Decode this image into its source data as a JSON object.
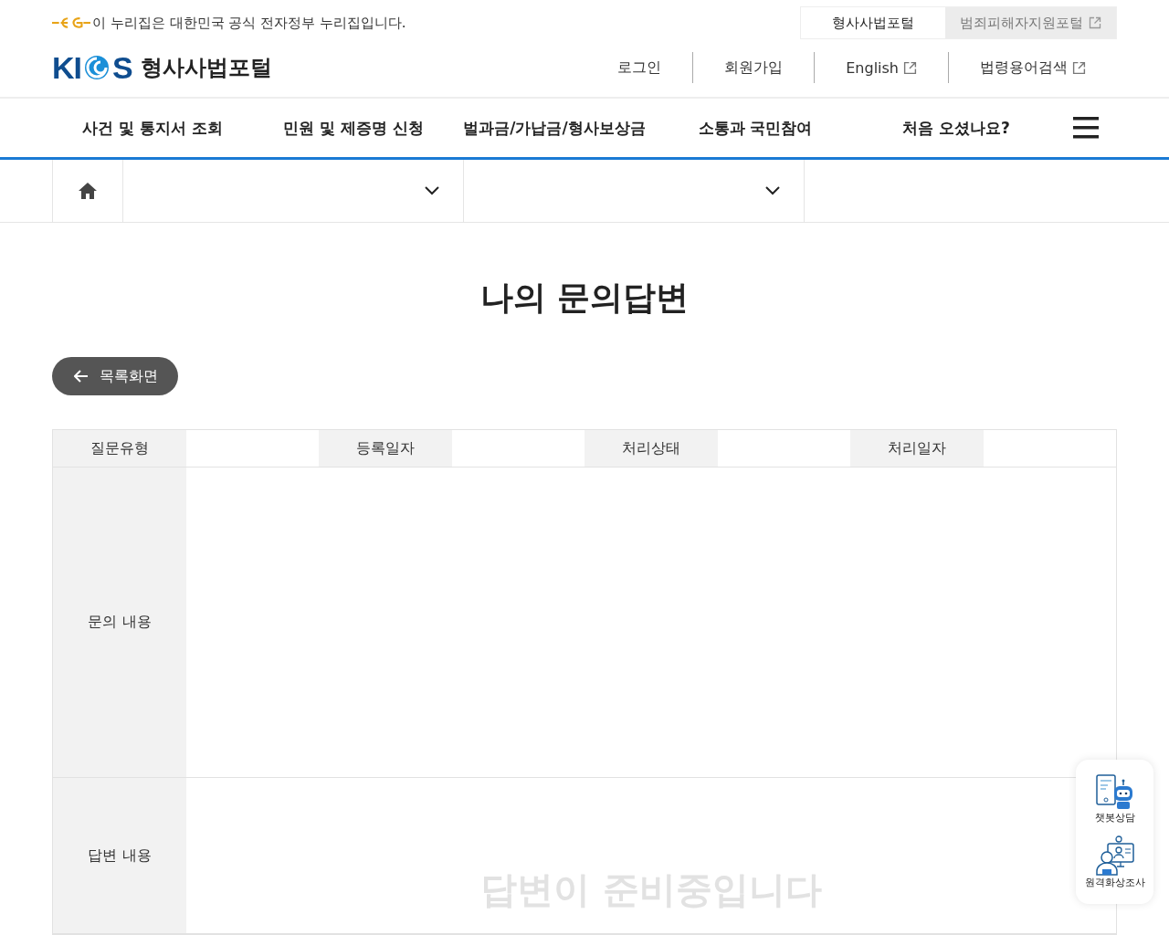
{
  "gov_banner": {
    "text": "이 누리집은 대한민국 공식 전자정부 누리집입니다."
  },
  "portal_tabs": [
    {
      "label": "형사사법포털",
      "selected": true,
      "external": false
    },
    {
      "label": "범죄피해자지원포털",
      "selected": false,
      "external": true
    }
  ],
  "logo": {
    "letters_left": "KI",
    "letters_right": "S",
    "title": "형사사법포털"
  },
  "util_links": [
    {
      "label": "로그인",
      "external": false
    },
    {
      "label": "회원가입",
      "external": false
    },
    {
      "label": "English",
      "external": true
    },
    {
      "label": "법령용어검색",
      "external": true
    }
  ],
  "nav": [
    {
      "label": "사건 및 통지서 조회"
    },
    {
      "label": "민원 및 제증명 신청"
    },
    {
      "label": "벌과금/가납금/형사보상금"
    },
    {
      "label": "소통과 국민참여"
    },
    {
      "label": "처음 오셨나요?"
    }
  ],
  "page_title": "나의 문의답변",
  "back_button": {
    "label": "목록화면"
  },
  "detail_table": {
    "header_fields": [
      {
        "label": "질문유형"
      },
      {
        "label": "등록일자"
      },
      {
        "label": "처리상태"
      },
      {
        "label": "처리일자"
      }
    ],
    "rows": [
      {
        "label": "문의 내용"
      },
      {
        "label": "답변 내용",
        "message": "답변이 준비중입니다"
      }
    ]
  },
  "quick_menu": [
    {
      "label": "챗봇상담",
      "kind": "chatbot"
    },
    {
      "label": "원격화상조사",
      "kind": "video"
    }
  ]
}
